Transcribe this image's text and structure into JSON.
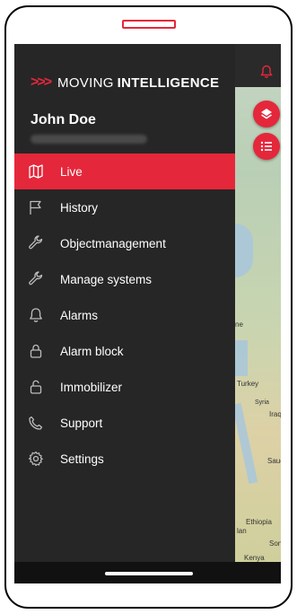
{
  "brand": {
    "chevrons": ">>>",
    "word_light": "MOVING",
    "word_bold": "INTELLIGENCE"
  },
  "user": {
    "name": "John Doe"
  },
  "menu": {
    "items": [
      {
        "label": "Live",
        "icon": "map-icon",
        "active": true
      },
      {
        "label": "History",
        "icon": "flag-icon",
        "active": false
      },
      {
        "label": "Objectmanagement",
        "icon": "wrench-icon",
        "active": false
      },
      {
        "label": "Manage systems",
        "icon": "wrench-icon",
        "active": false
      },
      {
        "label": "Alarms",
        "icon": "bell-icon",
        "active": false
      },
      {
        "label": "Alarm block",
        "icon": "lock-icon",
        "active": false
      },
      {
        "label": "Immobilizer",
        "icon": "unlock-icon",
        "active": false
      },
      {
        "label": "Support",
        "icon": "phone-icon",
        "active": false
      },
      {
        "label": "Settings",
        "icon": "gear-icon",
        "active": false
      }
    ]
  },
  "map": {
    "labels": [
      "ne",
      "Turkey",
      "Syria",
      "Iraq",
      "Saudi",
      "Ethiopia",
      "lan",
      "Son",
      "Kenya"
    ]
  },
  "colors": {
    "accent": "#e5273b",
    "drawer_bg": "#262626"
  }
}
